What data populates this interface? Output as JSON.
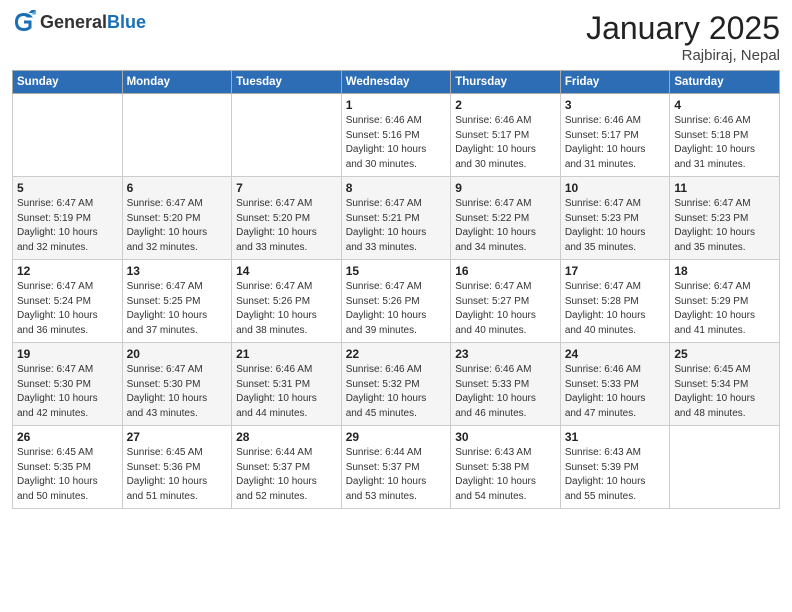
{
  "header": {
    "logo_general": "General",
    "logo_blue": "Blue",
    "month_title": "January 2025",
    "location": "Rajbiraj, Nepal"
  },
  "days_of_week": [
    "Sunday",
    "Monday",
    "Tuesday",
    "Wednesday",
    "Thursday",
    "Friday",
    "Saturday"
  ],
  "weeks": [
    [
      {
        "day": "",
        "info": ""
      },
      {
        "day": "",
        "info": ""
      },
      {
        "day": "",
        "info": ""
      },
      {
        "day": "1",
        "info": "Sunrise: 6:46 AM\nSunset: 5:16 PM\nDaylight: 10 hours\nand 30 minutes."
      },
      {
        "day": "2",
        "info": "Sunrise: 6:46 AM\nSunset: 5:17 PM\nDaylight: 10 hours\nand 30 minutes."
      },
      {
        "day": "3",
        "info": "Sunrise: 6:46 AM\nSunset: 5:17 PM\nDaylight: 10 hours\nand 31 minutes."
      },
      {
        "day": "4",
        "info": "Sunrise: 6:46 AM\nSunset: 5:18 PM\nDaylight: 10 hours\nand 31 minutes."
      }
    ],
    [
      {
        "day": "5",
        "info": "Sunrise: 6:47 AM\nSunset: 5:19 PM\nDaylight: 10 hours\nand 32 minutes."
      },
      {
        "day": "6",
        "info": "Sunrise: 6:47 AM\nSunset: 5:20 PM\nDaylight: 10 hours\nand 32 minutes."
      },
      {
        "day": "7",
        "info": "Sunrise: 6:47 AM\nSunset: 5:20 PM\nDaylight: 10 hours\nand 33 minutes."
      },
      {
        "day": "8",
        "info": "Sunrise: 6:47 AM\nSunset: 5:21 PM\nDaylight: 10 hours\nand 33 minutes."
      },
      {
        "day": "9",
        "info": "Sunrise: 6:47 AM\nSunset: 5:22 PM\nDaylight: 10 hours\nand 34 minutes."
      },
      {
        "day": "10",
        "info": "Sunrise: 6:47 AM\nSunset: 5:23 PM\nDaylight: 10 hours\nand 35 minutes."
      },
      {
        "day": "11",
        "info": "Sunrise: 6:47 AM\nSunset: 5:23 PM\nDaylight: 10 hours\nand 35 minutes."
      }
    ],
    [
      {
        "day": "12",
        "info": "Sunrise: 6:47 AM\nSunset: 5:24 PM\nDaylight: 10 hours\nand 36 minutes."
      },
      {
        "day": "13",
        "info": "Sunrise: 6:47 AM\nSunset: 5:25 PM\nDaylight: 10 hours\nand 37 minutes."
      },
      {
        "day": "14",
        "info": "Sunrise: 6:47 AM\nSunset: 5:26 PM\nDaylight: 10 hours\nand 38 minutes."
      },
      {
        "day": "15",
        "info": "Sunrise: 6:47 AM\nSunset: 5:26 PM\nDaylight: 10 hours\nand 39 minutes."
      },
      {
        "day": "16",
        "info": "Sunrise: 6:47 AM\nSunset: 5:27 PM\nDaylight: 10 hours\nand 40 minutes."
      },
      {
        "day": "17",
        "info": "Sunrise: 6:47 AM\nSunset: 5:28 PM\nDaylight: 10 hours\nand 40 minutes."
      },
      {
        "day": "18",
        "info": "Sunrise: 6:47 AM\nSunset: 5:29 PM\nDaylight: 10 hours\nand 41 minutes."
      }
    ],
    [
      {
        "day": "19",
        "info": "Sunrise: 6:47 AM\nSunset: 5:30 PM\nDaylight: 10 hours\nand 42 minutes."
      },
      {
        "day": "20",
        "info": "Sunrise: 6:47 AM\nSunset: 5:30 PM\nDaylight: 10 hours\nand 43 minutes."
      },
      {
        "day": "21",
        "info": "Sunrise: 6:46 AM\nSunset: 5:31 PM\nDaylight: 10 hours\nand 44 minutes."
      },
      {
        "day": "22",
        "info": "Sunrise: 6:46 AM\nSunset: 5:32 PM\nDaylight: 10 hours\nand 45 minutes."
      },
      {
        "day": "23",
        "info": "Sunrise: 6:46 AM\nSunset: 5:33 PM\nDaylight: 10 hours\nand 46 minutes."
      },
      {
        "day": "24",
        "info": "Sunrise: 6:46 AM\nSunset: 5:33 PM\nDaylight: 10 hours\nand 47 minutes."
      },
      {
        "day": "25",
        "info": "Sunrise: 6:45 AM\nSunset: 5:34 PM\nDaylight: 10 hours\nand 48 minutes."
      }
    ],
    [
      {
        "day": "26",
        "info": "Sunrise: 6:45 AM\nSunset: 5:35 PM\nDaylight: 10 hours\nand 50 minutes."
      },
      {
        "day": "27",
        "info": "Sunrise: 6:45 AM\nSunset: 5:36 PM\nDaylight: 10 hours\nand 51 minutes."
      },
      {
        "day": "28",
        "info": "Sunrise: 6:44 AM\nSunset: 5:37 PM\nDaylight: 10 hours\nand 52 minutes."
      },
      {
        "day": "29",
        "info": "Sunrise: 6:44 AM\nSunset: 5:37 PM\nDaylight: 10 hours\nand 53 minutes."
      },
      {
        "day": "30",
        "info": "Sunrise: 6:43 AM\nSunset: 5:38 PM\nDaylight: 10 hours\nand 54 minutes."
      },
      {
        "day": "31",
        "info": "Sunrise: 6:43 AM\nSunset: 5:39 PM\nDaylight: 10 hours\nand 55 minutes."
      },
      {
        "day": "",
        "info": ""
      }
    ]
  ]
}
